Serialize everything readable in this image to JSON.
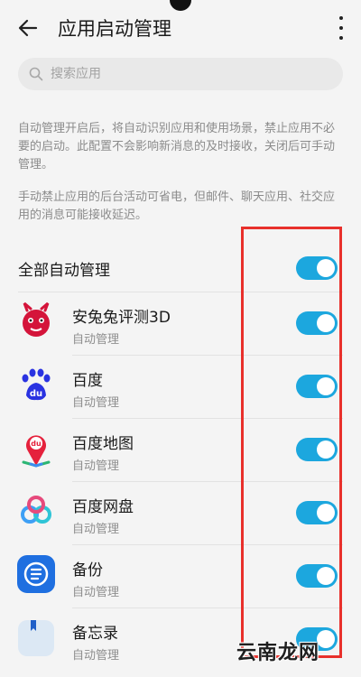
{
  "header": {
    "title": "应用启动管理"
  },
  "search": {
    "placeholder": "搜索应用"
  },
  "descriptions": [
    "自动管理开启后，将自动识别应用和使用场景，禁止应用不必要的启动。此配置不会影响新消息的及时接收，关闭后可手动管理。",
    "手动禁止应用的后台活动可省电，但邮件、聊天应用、社交应用的消息可能接收延迟。"
  ],
  "all_auto": {
    "label": "全部自动管理",
    "enabled": true
  },
  "apps": [
    {
      "name": "安兔兔评测3D",
      "status": "自动管理",
      "enabled": true,
      "icon": "antutu-icon"
    },
    {
      "name": "百度",
      "status": "自动管理",
      "enabled": true,
      "icon": "baidu-paw-icon"
    },
    {
      "name": "百度地图",
      "status": "自动管理",
      "enabled": true,
      "icon": "baidu-map-icon"
    },
    {
      "name": "百度网盘",
      "status": "自动管理",
      "enabled": true,
      "icon": "baidu-netdisk-icon"
    },
    {
      "name": "备份",
      "status": "自动管理",
      "enabled": true,
      "icon": "backup-icon"
    },
    {
      "name": "备忘录",
      "status": "自动管理",
      "enabled": true,
      "icon": "notepad-icon"
    }
  ],
  "watermark": "云南龙网",
  "colors": {
    "toggle_on": "#1ca7de",
    "highlight": "#e8302b",
    "background": "#f4f4f4"
  }
}
